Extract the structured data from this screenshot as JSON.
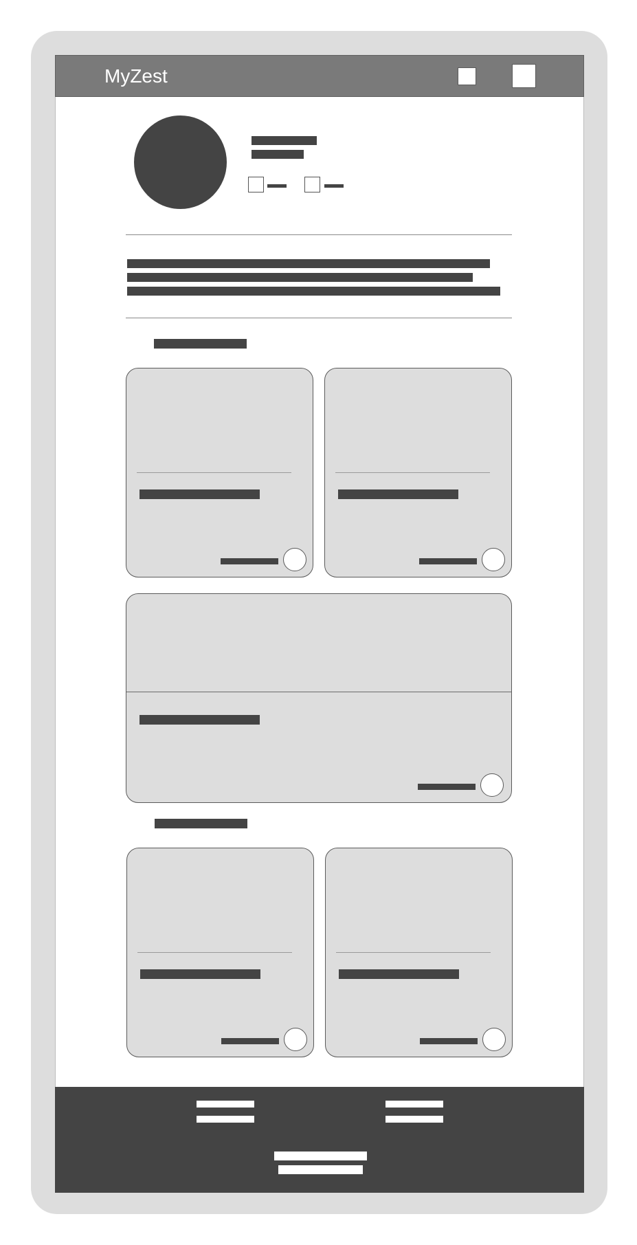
{
  "app": {
    "title": "MyZest"
  },
  "header": {
    "icons": [
      "square-icon",
      "square-icon"
    ]
  },
  "profile": {
    "avatar_icon": "avatar-circle",
    "stats": [
      "checkbox",
      "checkbox"
    ]
  },
  "colors": {
    "frame": "#dddddd",
    "topbar": "#7a7a7a",
    "placeholder_bar": "#444444",
    "card": "#dddddd",
    "footer": "#444444"
  }
}
